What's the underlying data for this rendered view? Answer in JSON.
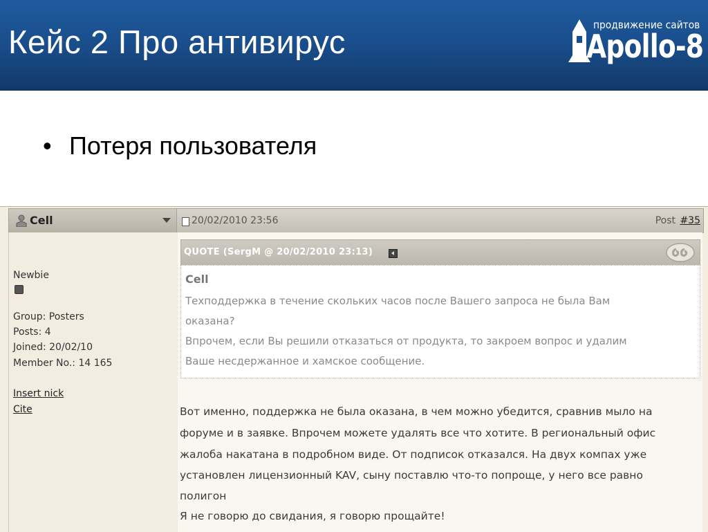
{
  "slide": {
    "title": "Кейс 2 Про антивирус",
    "bullet": "Потеря пользователя"
  },
  "logo": {
    "tagline": "продвижение сайтов",
    "name": "Apollo-8"
  },
  "forum": {
    "username": "Cell",
    "post_date": "20/02/2010 23:56",
    "post_label": "Post",
    "post_number": "#35",
    "user": {
      "rank": "Newbie",
      "group": "Group: Posters",
      "posts": "Posts: 4",
      "joined": "Joined: 20/02/10",
      "member_no": "Member No.: 14 165",
      "insert_nick": "Insert nick",
      "cite": "Cite"
    },
    "quote": {
      "header": "QUOTE (SergM @ 20/02/2010 23:13)",
      "author": "Cell",
      "lines": [
        "Техподдержка в течение скольких часов после Вашего запроса не была Вам",
        "оказана?",
        "Впрочем, если Вы решили отказаться от продукта, то закроем вопрос и удалим",
        "Ваше несдержанное и хамское сообщение."
      ]
    },
    "message": [
      "Вот именно, поддержка не была оказана, в чем можно убедится, сравнив мыло на",
      "форуме и в заявке. Впрочем можете удалять все что хотите. В региональный офис",
      "жалоба накатана в подробном виде. От подписок отказался. На двух компах уже",
      "установлен лицензионный KAV, сыну поставлю что-то попроще, у него все равно",
      "полигон",
      "Я не говорю до свидания, я говорю прощайте!"
    ]
  },
  "colors": {
    "title_bar": "#1a4f8d",
    "forum_bg": "#f3ece0",
    "quote_text": "#8a8a8a"
  }
}
